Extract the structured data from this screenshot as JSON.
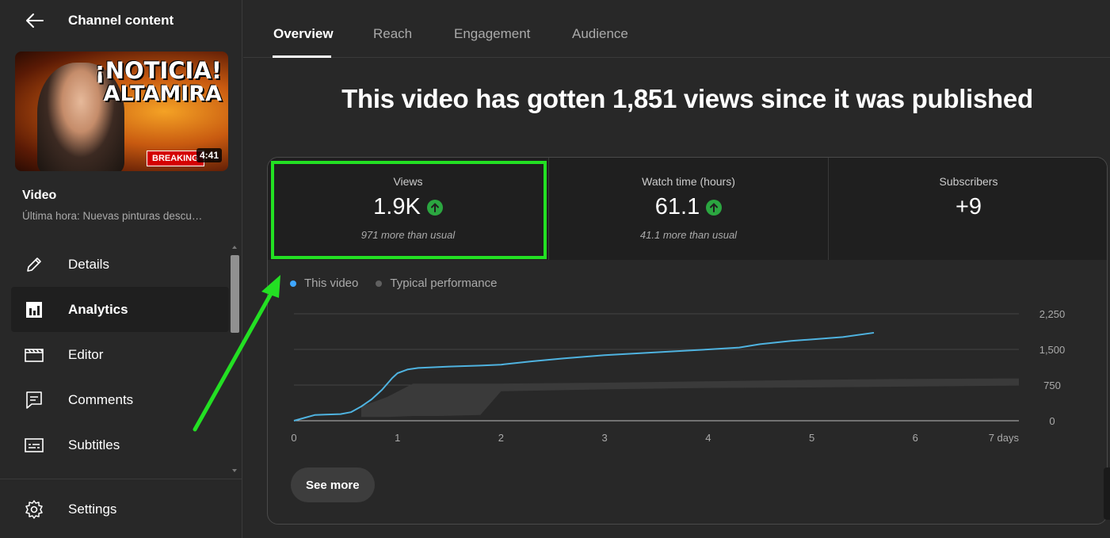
{
  "sidebar": {
    "title": "Channel content",
    "video_label": "Video",
    "video_title": "Última hora: Nuevas pinturas descu…",
    "thumbnail": {
      "headline_1": "¡NOTICIA!",
      "headline_2": "ALTAMIRA",
      "badge": "BREAKING",
      "duration": "4:41"
    },
    "nav": [
      {
        "label": "Details",
        "icon": "pencil-icon"
      },
      {
        "label": "Analytics",
        "icon": "analytics-icon",
        "active": true
      },
      {
        "label": "Editor",
        "icon": "clapperboard-icon"
      },
      {
        "label": "Comments",
        "icon": "comment-icon"
      },
      {
        "label": "Subtitles",
        "icon": "subtitles-icon"
      }
    ],
    "settings_label": "Settings"
  },
  "tabs": [
    {
      "label": "Overview",
      "active": true
    },
    {
      "label": "Reach"
    },
    {
      "label": "Engagement"
    },
    {
      "label": "Audience"
    }
  ],
  "headline": "This video has gotten 1,851 views since it was published",
  "metrics": [
    {
      "label": "Views",
      "value": "1.9K",
      "note": "971 more than usual",
      "trend": "up"
    },
    {
      "label": "Watch time (hours)",
      "value": "61.1",
      "note": "41.1 more than usual",
      "trend": "up"
    },
    {
      "label": "Subscribers",
      "value": "+9",
      "note": ""
    }
  ],
  "legend": [
    {
      "label": "This video",
      "color": "#3ea6ff"
    },
    {
      "label": "Typical performance",
      "color": "#606060"
    }
  ],
  "see_more_label": "See more",
  "colors": {
    "accent_line": "#4fb3e0",
    "trend_up": "#2ba640",
    "highlight": "#23e023",
    "band": "#3a3a3a"
  },
  "chart_data": {
    "type": "line",
    "x_tick_labels": [
      "0",
      "1",
      "2",
      "3",
      "4",
      "5",
      "6",
      "7 days"
    ],
    "y_tick_labels": [
      "2,250",
      "1,500",
      "750",
      "0"
    ],
    "ylim": [
      0,
      2250
    ],
    "xlim": [
      0,
      7
    ],
    "series": [
      {
        "name": "This video",
        "x": [
          0,
          0.1,
          0.2,
          0.3,
          0.45,
          0.55,
          0.65,
          0.75,
          0.85,
          0.95,
          1.0,
          1.1,
          1.2,
          1.5,
          1.8,
          2.0,
          2.3,
          2.6,
          3.0,
          3.5,
          4.0,
          4.3,
          4.5,
          4.8,
          5.0,
          5.3,
          5.6
        ],
        "y": [
          0,
          60,
          120,
          130,
          140,
          180,
          300,
          450,
          650,
          900,
          1000,
          1080,
          1110,
          1140,
          1160,
          1180,
          1250,
          1310,
          1380,
          1440,
          1500,
          1540,
          1610,
          1680,
          1710,
          1760,
          1851
        ]
      },
      {
        "name": "Typical performance",
        "x": [
          0.65,
          0.9,
          1.15,
          1.4,
          1.8,
          2.0,
          3.0,
          4.0,
          5.0,
          6.0,
          7.0
        ],
        "low": [
          80,
          80,
          100,
          100,
          120,
          620,
          660,
          690,
          700,
          720,
          740
        ],
        "high": [
          300,
          500,
          780,
          780,
          780,
          780,
          800,
          830,
          860,
          880,
          890
        ]
      }
    ]
  }
}
